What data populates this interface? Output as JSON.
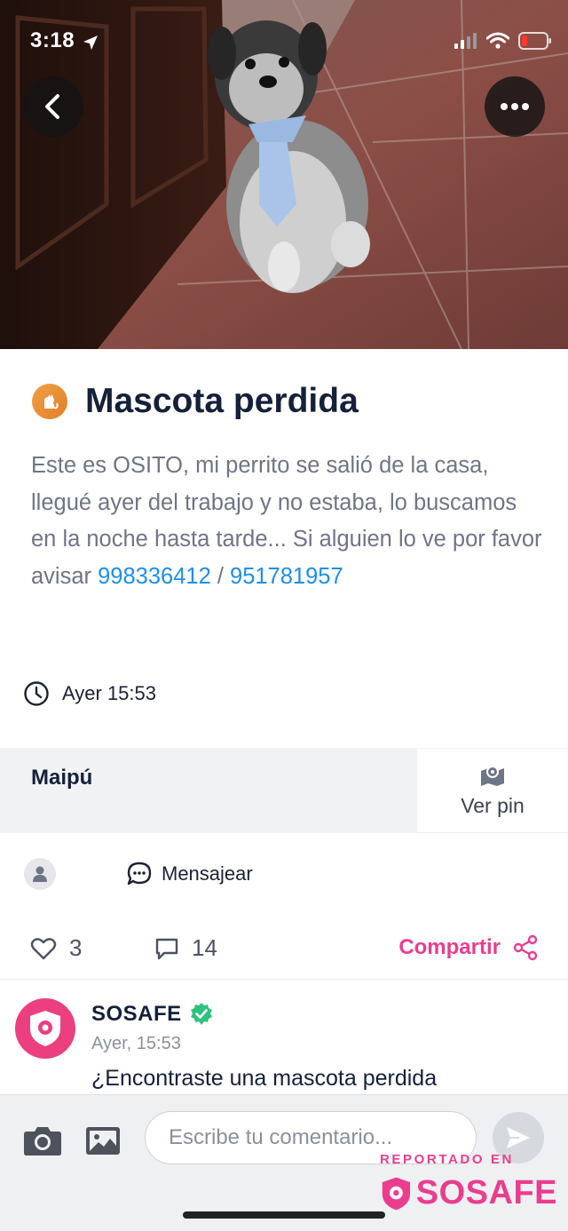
{
  "status_bar": {
    "time": "3:18"
  },
  "hero": {
    "image_description_icon": "lost-dog-photo"
  },
  "post": {
    "category_icon": "cat-icon",
    "title": "Mascota perdida",
    "description_text": "Este es OSITO, mi perrito se salió de la casa, llegué ayer del trabajo y no estaba, lo buscamos en la noche hasta tarde... Si alguien lo ve por favor avisar ",
    "phone_1": "998336412",
    "phone_separator": " / ",
    "phone_2": "951781957",
    "timestamp": "Ayer 15:53"
  },
  "location": {
    "name": "Maipú",
    "pin_label": "Ver pin"
  },
  "user": {
    "message_label": "Mensajear"
  },
  "actions": {
    "likes": "3",
    "comments": "14",
    "share_label": "Compartir"
  },
  "comment": {
    "author": "SOSAFE",
    "time": "Ayer, 15:53",
    "text": "¿Encontraste una mascota perdida"
  },
  "composer": {
    "placeholder": "Escribe tu comentario..."
  },
  "watermark": {
    "small": "REPORTADO EN",
    "brand": "SOSAFE"
  },
  "colors": {
    "accent_pink": "#ea3d8d",
    "link_blue": "#1d8fe8",
    "category_orange": "#e88a30"
  }
}
